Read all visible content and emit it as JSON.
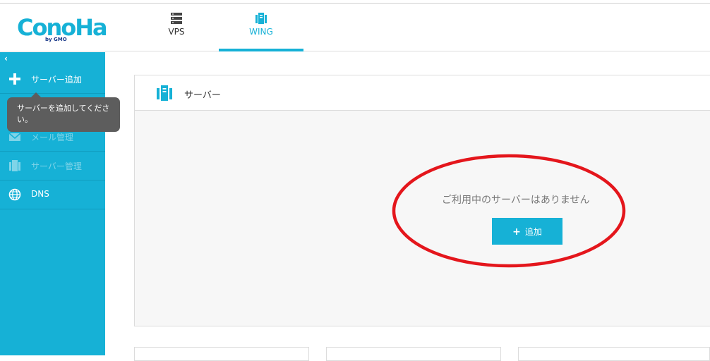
{
  "header": {
    "logo_main": "ConoHa",
    "logo_sub": "by GMO",
    "tabs": [
      {
        "label": "VPS",
        "icon": "server-stack-icon",
        "active": false
      },
      {
        "label": "WING",
        "icon": "wing-icon",
        "active": true
      }
    ]
  },
  "sidebar": {
    "collapse_glyph": "‹",
    "items": [
      {
        "label": "サーバー追加",
        "icon": "plus-icon",
        "disabled": false
      },
      {
        "label": "メール管理",
        "icon": "mail-icon",
        "disabled": true
      },
      {
        "label": "サーバー管理",
        "icon": "server-icon",
        "disabled": true
      },
      {
        "label": "DNS",
        "icon": "globe-icon",
        "disabled": false
      }
    ],
    "tooltip": "サーバーを追加してください。"
  },
  "main": {
    "panel_title": "サーバー",
    "empty_message": "ご利用中のサーバーはありません",
    "add_button_label": "追加",
    "add_button_glyph": "+"
  },
  "colors": {
    "accent": "#16b1d6",
    "annotation_red": "#e4161c"
  }
}
